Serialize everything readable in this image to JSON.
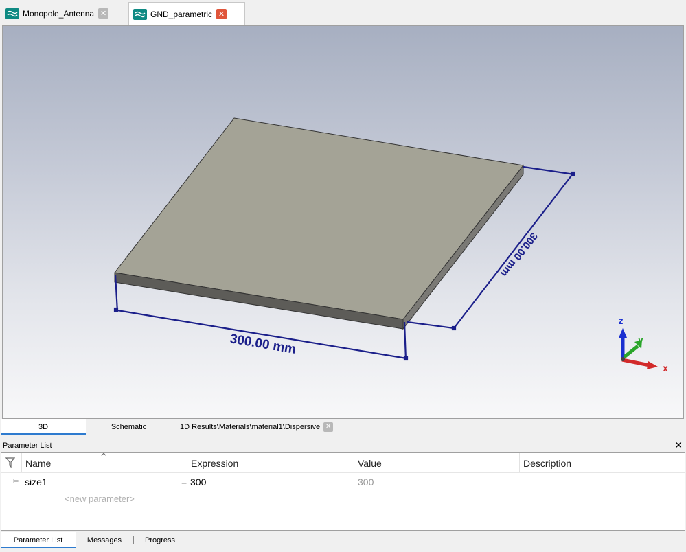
{
  "doc_tabs": [
    {
      "label": "Monopole_Antenna",
      "icon": "cst-project-icon",
      "active": false
    },
    {
      "label": "GND_parametric",
      "icon": "cst-project-icon",
      "active": true
    }
  ],
  "viewport": {
    "dimension_width": "300.00 mm",
    "dimension_depth": "300.00 mm",
    "axes": {
      "x": "x",
      "y": "y",
      "z": "z"
    },
    "colors": {
      "plate_top": "#a4a396",
      "plate_front": "#5d5c58",
      "plate_side": "#7a7975",
      "dimension": "#1b1f8a",
      "axis_x": "#d22a2a",
      "axis_y": "#2aa52a",
      "axis_z": "#1a2fd0"
    }
  },
  "view_tabs": {
    "tab_3d": "3D",
    "tab_schematic": "Schematic",
    "tab_results": "1D Results\\Materials\\material1\\Dispersive"
  },
  "param_panel": {
    "title": "Parameter List",
    "columns": {
      "name": "Name",
      "expression": "Expression",
      "value": "Value",
      "description": "Description"
    },
    "rows": [
      {
        "name": "size1",
        "expression": "300",
        "value": "300",
        "description": ""
      }
    ],
    "new_parameter_placeholder": "<new parameter>"
  },
  "bottom_tabs": {
    "parameter_list": "Parameter List",
    "messages": "Messages",
    "progress": "Progress"
  }
}
